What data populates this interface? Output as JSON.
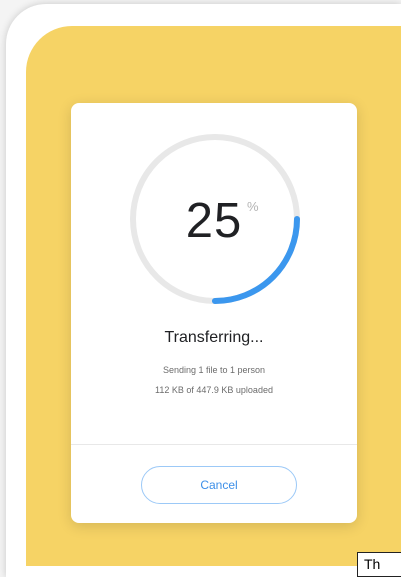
{
  "progress": {
    "percent_value": "25",
    "percent_sign": "%",
    "fraction": 0.25
  },
  "status": {
    "title": "Transferring...",
    "sending_text": "Sending 1 file to 1 person",
    "uploaded_text": "112 KB of 447.9 KB uploaded"
  },
  "actions": {
    "cancel_label": "Cancel"
  },
  "tooltip": {
    "text": "Th"
  },
  "colors": {
    "background_accent": "#f6d365",
    "progress_fill": "#3b97ee",
    "progress_track": "#e8e8e8",
    "cancel_border": "#9cc9f7",
    "cancel_text": "#3d8fe8"
  }
}
